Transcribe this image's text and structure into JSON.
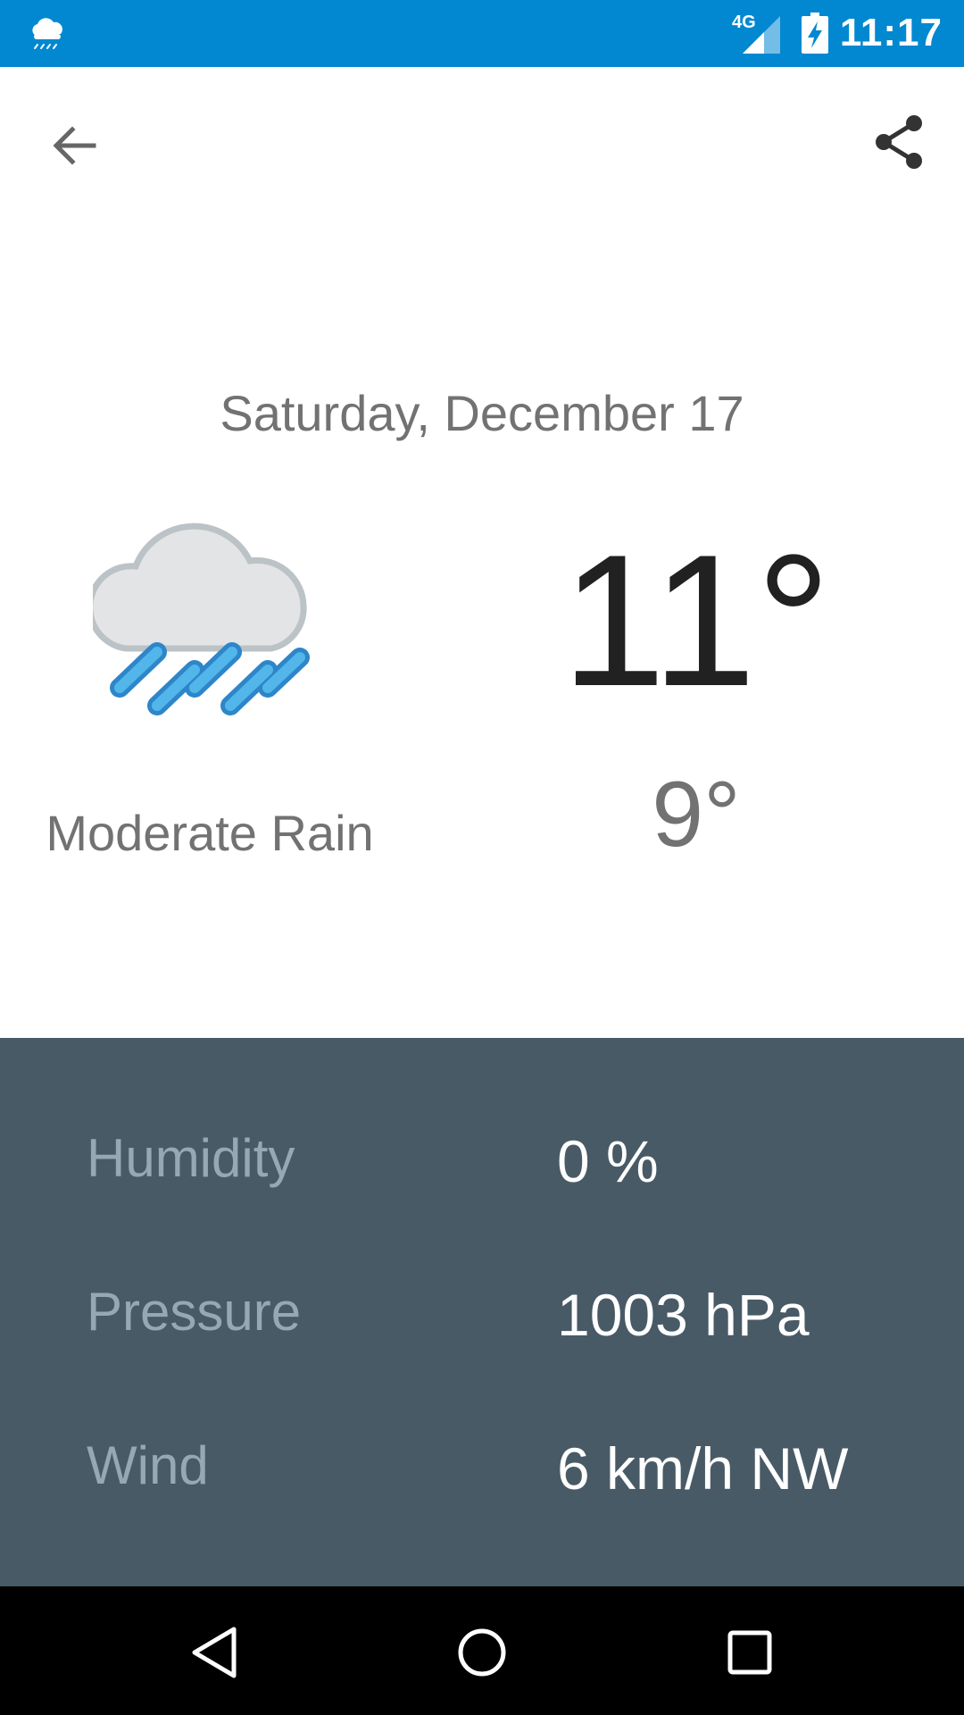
{
  "status_bar": {
    "network_label": "4G",
    "time": "11:17",
    "weather_icon": "rain-cloud-icon",
    "signal_icon": "cell-signal-icon",
    "battery_icon": "battery-charging-icon"
  },
  "toolbar": {
    "back_icon": "arrow-back-icon",
    "share_icon": "share-icon"
  },
  "forecast": {
    "date": "Saturday, December 17",
    "condition": "Moderate Rain",
    "condition_icon": "moderate-rain-icon",
    "high": "11°",
    "low": "9°"
  },
  "details": [
    {
      "label": "Humidity",
      "value": "0 %"
    },
    {
      "label": "Pressure",
      "value": "1003 hPa"
    },
    {
      "label": "Wind",
      "value": "6 km/h NW"
    }
  ],
  "nav_bar": {
    "back_icon": "nav-back-icon",
    "home_icon": "nav-home-icon",
    "recents_icon": "nav-recents-icon"
  },
  "colors": {
    "status_bar": "#0288D1",
    "detail_panel": "#485A66",
    "rain_accent": "#3FA9E0"
  }
}
